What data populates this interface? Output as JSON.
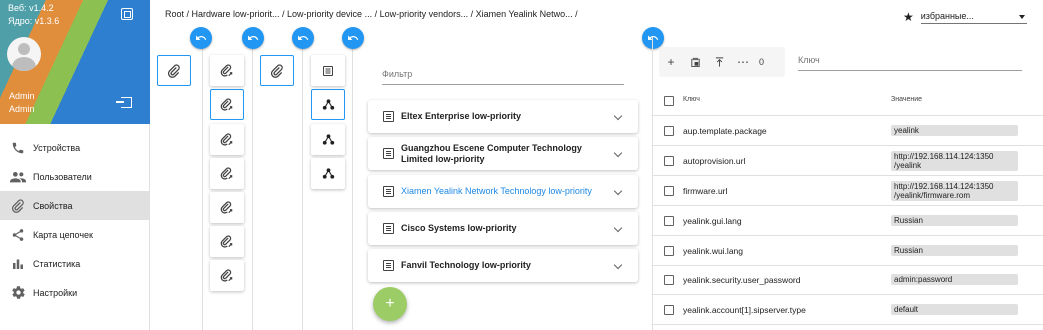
{
  "sidebar": {
    "version_web": "Веб: v1.4.2",
    "version_core": "Ядро: v1.3.6",
    "user_name": "Admin",
    "user_role": "Admin",
    "items": [
      {
        "label": "Устройства",
        "icon": "phone-icon"
      },
      {
        "label": "Пользователи",
        "icon": "people-icon"
      },
      {
        "label": "Свойства",
        "icon": "paperclip-icon",
        "active": true
      },
      {
        "label": "Карта цепочек",
        "icon": "share-icon"
      },
      {
        "label": "Статистика",
        "icon": "bar-chart-icon"
      },
      {
        "label": "Настройки",
        "icon": "gear-icon"
      }
    ]
  },
  "header": {
    "breadcrumb": "Root / Hardware low-priorit... / Low-priority device ... / Low-priority vendors... / Xiamen Yealink Netwo... /",
    "favorites_label": "избранные..."
  },
  "vendors": {
    "filter_placeholder": "Фильтр",
    "items": [
      {
        "label": "Eltex Enterprise low-priority",
        "selected": false
      },
      {
        "label": "Guangzhou Escene Computer Technology Limited low-priority",
        "selected": false
      },
      {
        "label": "Xiamen Yealink Network Technology low-priority",
        "selected": true
      },
      {
        "label": "Cisco Systems low-priority",
        "selected": false
      },
      {
        "label": "Fanvil Technology low-priority",
        "selected": false
      }
    ],
    "add_label": "+"
  },
  "properties": {
    "selected_count": "0",
    "key_placeholder": "Ключ",
    "col_key": "Ключ",
    "col_value": "Значение",
    "rows": [
      {
        "key": "aup.template.package",
        "value": "yealink"
      },
      {
        "key": "autoprovision.url",
        "value": "http://192.168.114.124:1350 /yealink"
      },
      {
        "key": "firmware.url",
        "value": "http://192.168.114.124:1350 /yealink/firmware.rom"
      },
      {
        "key": "yealink.gui.lang",
        "value": "Russian"
      },
      {
        "key": "yealink.wui.lang",
        "value": "Russian"
      },
      {
        "key": "yealink.security.user_password",
        "value": "admin:password"
      },
      {
        "key": "yealink.account[1].sipserver.type",
        "value": "default"
      }
    ]
  },
  "colors": {
    "accent": "#2196f3",
    "fab": "#9ccc65",
    "link": "#1e88e5"
  }
}
